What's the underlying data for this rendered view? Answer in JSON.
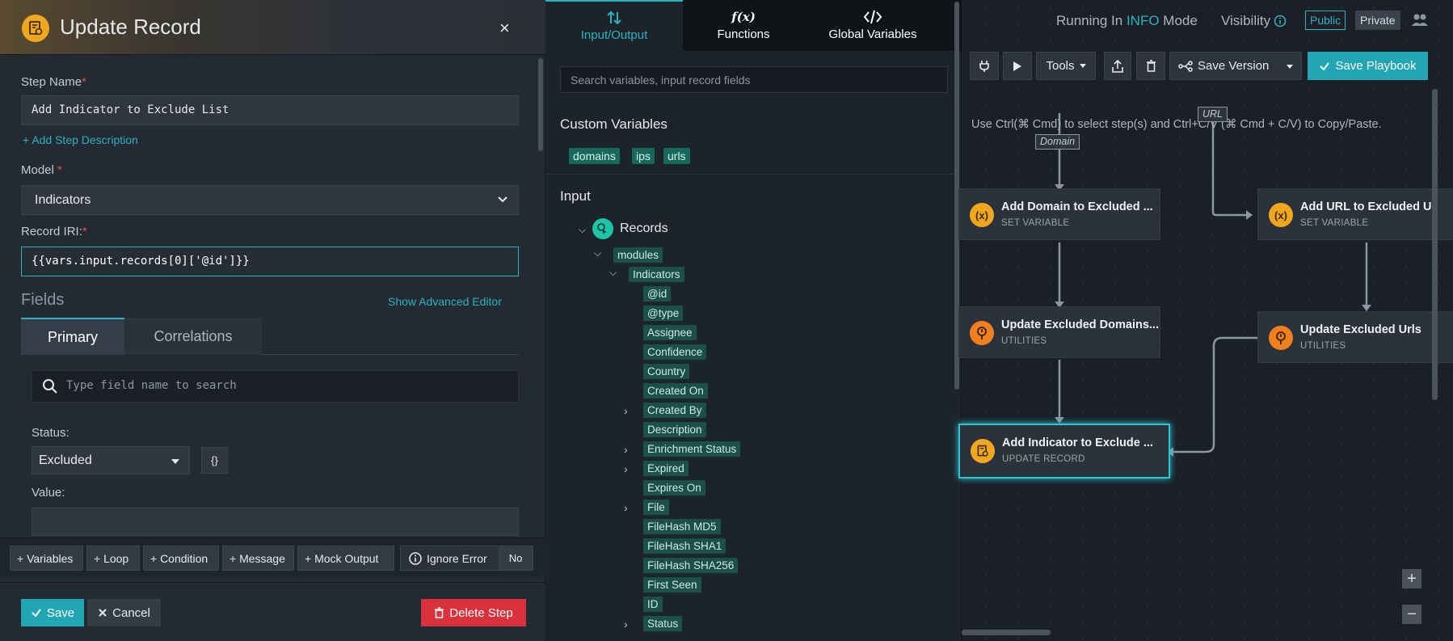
{
  "panel": {
    "title": "Update Record",
    "close": "×",
    "step_name_label": "Step Name",
    "required_mark": "*",
    "step_name_value": "Add Indicator to Exclude List",
    "add_description": "+ Add Step Description",
    "model_label": "Model ",
    "model_value": "Indicators",
    "record_iri_label": "Record IRI:",
    "record_iri_value": "{{vars.input.records[0]['@id']}}",
    "fields_title": "Fields",
    "advanced_editor": "Show Advanced Editor",
    "tab_primary": "Primary",
    "tab_correlations": "Correlations",
    "field_search_placeholder": "Type field name to search",
    "status_label": "Status:",
    "status_value": "Excluded",
    "brace_label": "{}",
    "value_label": "Value:"
  },
  "actions": {
    "variables": "+ Variables",
    "loop": "+ Loop",
    "condition": "+ Condition",
    "message": "+ Message",
    "mock_output": "+ Mock Output",
    "ignore_error": "Ignore Error",
    "ignore_value": "No"
  },
  "footer": {
    "save": "Save",
    "cancel": "Cancel",
    "delete": "Delete Step"
  },
  "middle": {
    "tab_io": "Input/Output",
    "tab_functions": "Functions",
    "tab_functions_icon": "f(x)",
    "tab_globals": "Global Variables",
    "search_placeholder": "Search variables, input record fields",
    "custom_vars_title": "Custom Variables",
    "custom_vars": [
      "domains",
      "ips",
      "urls"
    ],
    "input_title": "Input",
    "records": "Records",
    "modules": "modules",
    "indicators": "Indicators",
    "fields": [
      {
        "label": "@id"
      },
      {
        "label": "@type"
      },
      {
        "label": "Assignee"
      },
      {
        "label": "Confidence"
      },
      {
        "label": "Country"
      },
      {
        "label": "Created On"
      },
      {
        "label": "Created By",
        "expandable": true
      },
      {
        "label": "Description"
      },
      {
        "label": "Enrichment Status",
        "expandable": true
      },
      {
        "label": "Expired",
        "expandable": true
      },
      {
        "label": "Expires On"
      },
      {
        "label": "File",
        "expandable": true
      },
      {
        "label": "FileHash MD5"
      },
      {
        "label": "FileHash SHA1"
      },
      {
        "label": "FileHash SHA256"
      },
      {
        "label": "First Seen"
      },
      {
        "label": "ID"
      },
      {
        "label": "Status",
        "expandable": true
      }
    ]
  },
  "canvas": {
    "running_in": "Running In ",
    "mode_name": "INFO",
    "mode_suffix": " Mode",
    "visibility": "Visibility",
    "public": "Public",
    "private": "Private",
    "tools": "Tools",
    "save_version": "Save Version",
    "save_playbook": "Save Playbook",
    "hint": "Use Ctrl(⌘ Cmd) to select step(s) and Ctrl+C/V (⌘ Cmd + C/V) to Copy/Paste.",
    "edge_domain": "Domain",
    "edge_url": "URL",
    "nodes": {
      "add_domain": {
        "title": "Add Domain to Excluded ...",
        "sub": "SET VARIABLE"
      },
      "add_url": {
        "title": "Add URL to Excluded Ul",
        "sub": "SET VARIABLE"
      },
      "upd_domains": {
        "title": "Update Excluded Domains...",
        "sub": "UTILITIES"
      },
      "upd_urls": {
        "title": "Update Excluded Urls",
        "sub": "UTILITIES"
      },
      "add_indicator": {
        "title": "Add Indicator to Exclude ...",
        "sub": "UPDATE RECORD"
      }
    },
    "zoom_in": "+",
    "zoom_out": "−"
  },
  "colors": {
    "accent": "#2bb3c0",
    "danger": "#d9323c",
    "chip": "#17695e",
    "node_orange": "#f0a71e"
  }
}
